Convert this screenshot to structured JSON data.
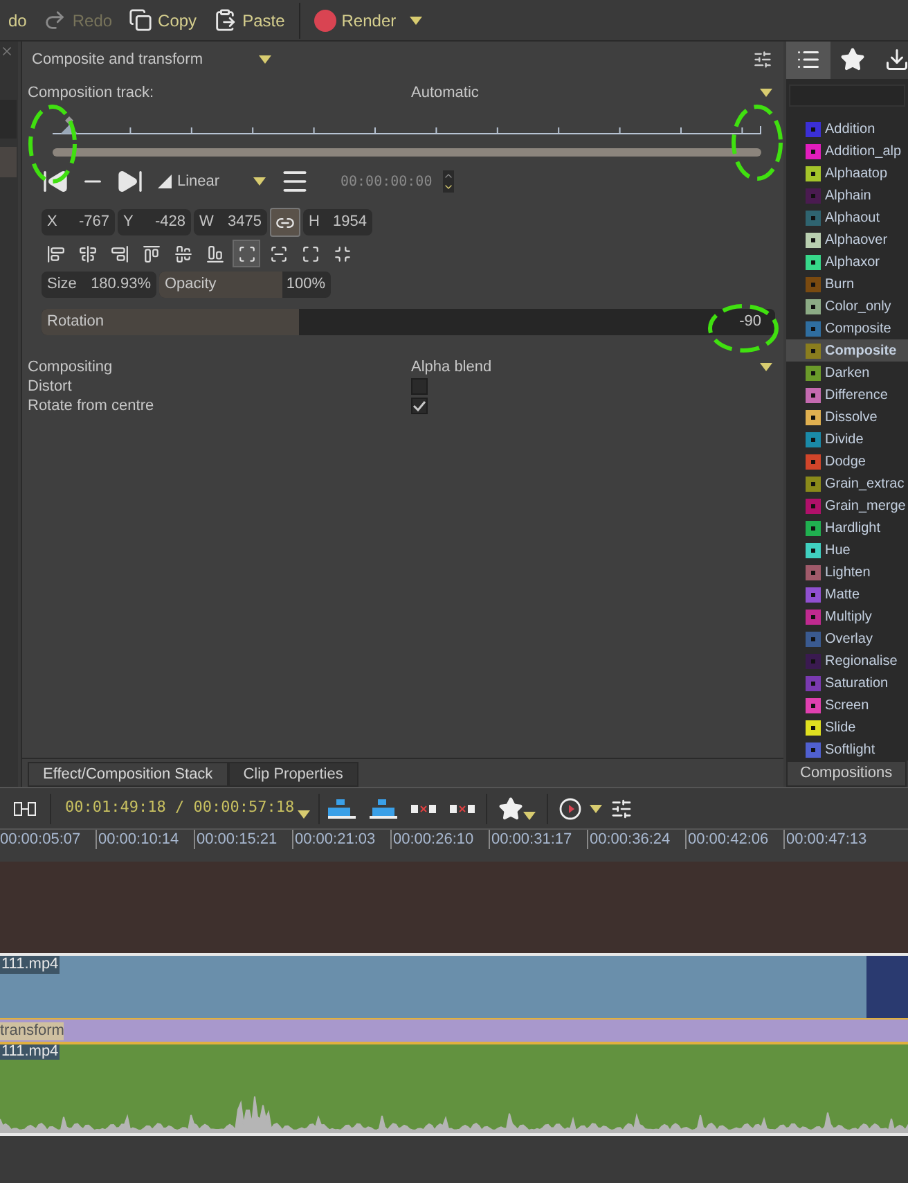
{
  "toolbar": {
    "items": [
      {
        "kind": "undo",
        "label": "do",
        "disabled": false
      },
      {
        "kind": "redo",
        "label": "Redo",
        "disabled": true
      },
      {
        "kind": "copy",
        "label": "Copy",
        "disabled": false
      },
      {
        "kind": "paste",
        "label": "Paste",
        "disabled": false
      },
      {
        "kind": "render",
        "label": "Render",
        "disabled": false
      }
    ]
  },
  "effect_panel": {
    "title": "Composite and transform",
    "track_label": "Composition track:",
    "track_value": "Automatic",
    "interpolation": "Linear",
    "timecode": "00:00:00:00",
    "geometry": [
      {
        "label": "X",
        "value": "-767"
      },
      {
        "label": "Y",
        "value": "-428"
      },
      {
        "label": "W",
        "value": "3475"
      },
      {
        "label": "H",
        "value": "1954"
      }
    ],
    "linked": true,
    "align_tools": [
      {
        "kind": "left",
        "selected": false
      },
      {
        "kind": "hcenter",
        "selected": false
      },
      {
        "kind": "right",
        "selected": false
      },
      {
        "kind": "top",
        "selected": false
      },
      {
        "kind": "vcenter",
        "selected": false
      },
      {
        "kind": "bottom",
        "selected": false
      },
      {
        "kind": "fit",
        "selected": true
      },
      {
        "kind": "fit-width",
        "selected": false
      },
      {
        "kind": "fit-height",
        "selected": false
      },
      {
        "kind": "fit-center",
        "selected": false
      }
    ],
    "size": {
      "label": "Size",
      "value": "180.93%"
    },
    "opacity": {
      "label": "Opacity",
      "value": "100%",
      "level": 0.72
    },
    "rotation": {
      "label": "Rotation",
      "value": "-90",
      "level": 0.35
    },
    "params": [
      {
        "kind": "dropdown",
        "label": "Compositing",
        "value": "Alpha blend"
      },
      {
        "kind": "checkbox",
        "label": "Distort",
        "checked": false
      },
      {
        "kind": "checkbox",
        "label": "Rotate from centre",
        "checked": true
      }
    ],
    "tabs": [
      {
        "label": "Effect/Composition Stack",
        "selected": true
      },
      {
        "label": "Clip Properties",
        "selected": false
      }
    ]
  },
  "compositions_panel": {
    "tabs": [
      {
        "kind": "list",
        "selected": true
      },
      {
        "kind": "star",
        "selected": false
      },
      {
        "kind": "download",
        "selected": false
      }
    ],
    "items": [
      {
        "label": "Addition",
        "color": "#3b2fd6",
        "selected": false
      },
      {
        "label": "Addition_alp",
        "color": "#e21dbd",
        "selected": false
      },
      {
        "label": "Alphaatop",
        "color": "#a4c42a",
        "selected": false
      },
      {
        "label": "Alphain",
        "color": "#4a1b50",
        "selected": false
      },
      {
        "label": "Alphaout",
        "color": "#2f6470",
        "selected": false
      },
      {
        "label": "Alphaover",
        "color": "#b9cfb0",
        "selected": false
      },
      {
        "label": "Alphaxor",
        "color": "#37d88a",
        "selected": false
      },
      {
        "label": "Burn",
        "color": "#7a4a10",
        "selected": false
      },
      {
        "label": "Color_only",
        "color": "#8cab85",
        "selected": false
      },
      {
        "label": "Composite",
        "color": "#2f6ea0",
        "selected": false
      },
      {
        "label": "Composite",
        "color": "#8a7d1e",
        "selected": true
      },
      {
        "label": "Darken",
        "color": "#6a9a2a",
        "selected": false
      },
      {
        "label": "Difference",
        "color": "#c46ab0",
        "selected": false
      },
      {
        "label": "Dissolve",
        "color": "#e0b050",
        "selected": false
      },
      {
        "label": "Divide",
        "color": "#1a8aa8",
        "selected": false
      },
      {
        "label": "Dodge",
        "color": "#d0452a",
        "selected": false
      },
      {
        "label": "Grain_extrac",
        "color": "#8a8a1a",
        "selected": false
      },
      {
        "label": "Grain_merge",
        "color": "#b0106a",
        "selected": false
      },
      {
        "label": "Hardlight",
        "color": "#20b050",
        "selected": false
      },
      {
        "label": "Hue",
        "color": "#40d0c0",
        "selected": false
      },
      {
        "label": "Lighten",
        "color": "#a05a6a",
        "selected": false
      },
      {
        "label": "Matte",
        "color": "#9050d0",
        "selected": false
      },
      {
        "label": "Multiply",
        "color": "#c02a90",
        "selected": false
      },
      {
        "label": "Overlay",
        "color": "#3a5a90",
        "selected": false
      },
      {
        "label": "Regionalise",
        "color": "#3a1a50",
        "selected": false
      },
      {
        "label": "Saturation",
        "color": "#7a3ab0",
        "selected": false
      },
      {
        "label": "Screen",
        "color": "#e040b0",
        "selected": false
      },
      {
        "label": "Slide",
        "color": "#e0e020",
        "selected": false
      },
      {
        "label": "Softlight",
        "color": "#5060d0",
        "selected": false
      }
    ],
    "bottom_tab": "Compositions"
  },
  "timeline": {
    "timecode": "00:01:49:18 / 00:00:57:18",
    "ruler": [
      "00:00:05:07",
      "00:00:10:14",
      "00:00:15:21",
      "00:00:21:03",
      "00:00:26:10",
      "00:00:31:17",
      "00:00:36:24",
      "00:00:42:06",
      "00:00:47:13"
    ],
    "video_clip": "111.mp4",
    "composition": "transform",
    "audio_clip": "111.mp4"
  }
}
